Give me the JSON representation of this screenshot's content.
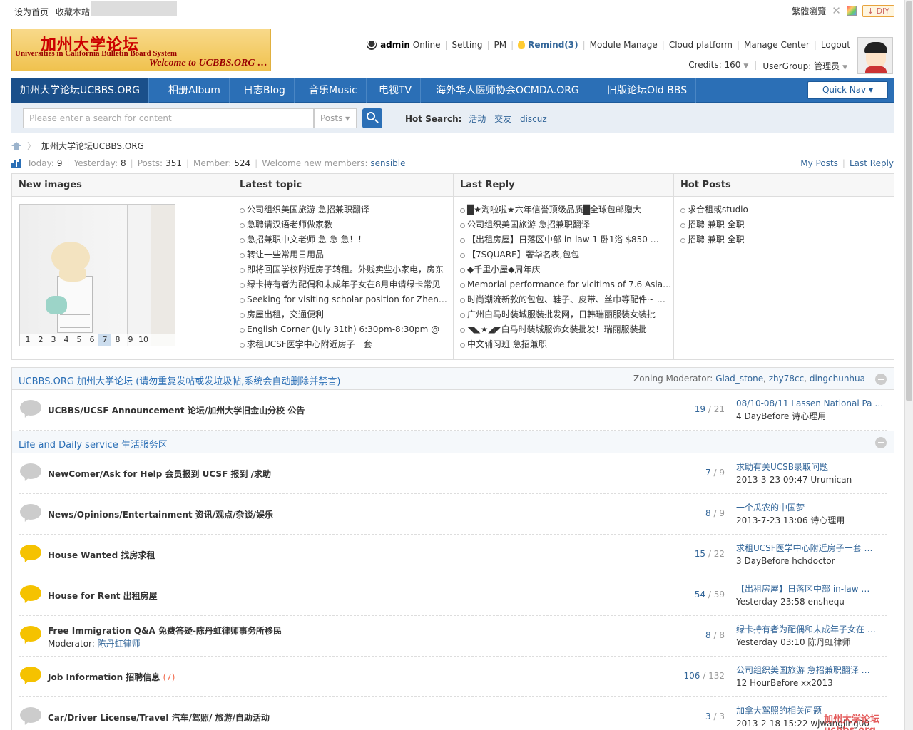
{
  "topbar": {
    "set_home": "设为首页",
    "bookmark": "收藏本站",
    "traditional": "繁體瀏覽",
    "diy": "DIY"
  },
  "logo": {
    "title_cn": "加州大学论坛",
    "title_en": "Universities in California Bulletin Board System",
    "welcome": "Welcome to UCBBS.ORG …"
  },
  "user": {
    "name": "admin",
    "status": "Online",
    "links": [
      "Setting",
      "PM"
    ],
    "remind": "Remind(3)",
    "links2": [
      "Module Manage",
      "Cloud platform",
      "Manage Center",
      "Logout"
    ],
    "credits": "Credits: 160",
    "usergroup": "UserGroup: 管理员"
  },
  "nav": {
    "items": [
      "加州大学论坛UCBBS.ORG",
      "相册Album",
      "日志Blog",
      "音乐Music",
      "电视TV",
      "海外华人医师协会OCMDA.ORG",
      "旧版论坛Old BBS"
    ],
    "quick_nav": "Quick Nav ▾"
  },
  "search": {
    "placeholder": "Please enter a search for content",
    "type": "Posts ▾",
    "hot_label": "Hot Search:",
    "hot": [
      "活动",
      "交友",
      "discuz"
    ]
  },
  "breadcrumb": {
    "current": "加州大学论坛UCBBS.ORG"
  },
  "stats": {
    "today_label": "Today:",
    "today": "9",
    "yesterday_label": "Yesterday:",
    "yesterday": "8",
    "posts_label": "Posts:",
    "posts": "351",
    "member_label": "Member:",
    "member": "524",
    "welcome_label": "Welcome new members:",
    "welcome_user": "sensible",
    "my_posts": "My Posts",
    "last_reply": "Last Reply"
  },
  "grid": {
    "images_title": "New images",
    "pager": [
      "1",
      "2",
      "3",
      "4",
      "5",
      "6",
      "7",
      "8",
      "9",
      "10"
    ],
    "pager_current": 6,
    "latest_title": "Latest topic",
    "latest": [
      "公司组织美国旅游 急招兼职翻译",
      "急聘请汉语老师做家教",
      "急招兼职中文老师 急 急 急！！",
      "转让一些常用日用品",
      "即将回国学校附近房子转租。外贱卖些小家电，房东",
      "绿卡持有者为配偶和未成年子女在8月申请绿卡常见",
      "Seeking for visiting scholar position for Zhenwei …",
      "房屋出租，交通便利",
      "English Corner (July 31th) 6:30pm-8:30pm @",
      "求租UCSF医学中心附近房子一套"
    ],
    "reply_title": "Last Reply",
    "replies": [
      "█★淘啦啦★六年信誉顶级品质█全球包邮赠大",
      "公司组织美国旅游 急招兼职翻译",
      "【出租房屋】日落区中部 in-law 1 卧1浴 $850 …",
      "【7SQUARE】奢华名表,包包",
      "◆千里小屋◆周年庆",
      "Memorial performance for vicitims of 7.6 Asiana fl",
      "时尚潮流新款的包包、鞋子、皮带、丝巾等配件~ …",
      "广州白马时装城服装批发网，日韩瑞丽服装女装批",
      "◥◣★◢◤白马时装城服饰女装批发！瑞丽服装批",
      "中文辅习班 急招兼职"
    ],
    "hot_title": "Hot Posts",
    "hot": [
      "求合租或studio",
      "招聘 兼职 全职",
      "招聘 兼职 全职"
    ]
  },
  "sections": [
    {
      "title": "UCBBS.ORG 加州大学论坛 (请勿重复发帖或发垃圾帖,系统会自动删除并禁言)",
      "mods_label": "Zoning Moderator:",
      "mods": [
        "Glad_stone",
        "zhy78cc",
        "dingchunhua"
      ]
    },
    {
      "title": "Life and Daily service 生活服务区"
    }
  ],
  "forums": [
    {
      "name": "UCBBS/UCSF Announcement 论坛/加州大学旧金山分校 公告",
      "threads": "19",
      "posts": "21",
      "last_title": "08/10-08/11 Lassen National Pa …",
      "last_meta": "4 DayBefore 诗心理用",
      "new": false
    },
    {
      "name": "NewComer/Ask for Help 会员报到 UCSF 报到 /求助",
      "threads": "7",
      "posts": "9",
      "last_title": "求助有关UCSB录取问题",
      "last_meta": "2013-3-23 09:47 Urumican",
      "new": false
    },
    {
      "name": "News/Opinions/Entertainment 资讯/观点/杂谈/娱乐",
      "threads": "8",
      "posts": "9",
      "last_title": "一个瓜农的中国梦",
      "last_meta": "2013-7-23 13:06 诗心理用",
      "new": false
    },
    {
      "name": "House Wanted 找房求租",
      "threads": "15",
      "posts": "22",
      "last_title": "求租UCSF医学中心附近房子一套 …",
      "last_meta": "3 DayBefore hchdoctor",
      "new": true
    },
    {
      "name": "House for Rent 出租房屋",
      "threads": "54",
      "posts": "59",
      "last_title": "【出租房屋】日落区中部 in-law …",
      "last_meta": "Yesterday 23:58 enshequ",
      "new": true
    },
    {
      "name": "Free Immigration Q&A 免费答疑-陈丹虹律师事务所移民",
      "moderator_label": "Moderator:",
      "moderator": "陈丹虹律师",
      "threads": "8",
      "posts": "8",
      "last_title": "绿卡持有者为配偶和未成年子女在 …",
      "last_meta": "Yesterday 03:10 陈丹虹律师",
      "new": true
    },
    {
      "name": "Job Information 招聘信息",
      "today": "(7)",
      "threads": "106",
      "posts": "132",
      "last_title": "公司组织美国旅游 急招兼职翻译 …",
      "last_meta": "12 HourBefore xx2013",
      "new": true
    },
    {
      "name": "Car/Driver License/Travel 汽车/驾照/ 旅游/自助活动",
      "threads": "3",
      "posts": "3",
      "last_title": "加拿大驾照的相关问题",
      "last_meta": "2013-2-18 15:22 wjwangjing00",
      "new": false
    }
  ],
  "watermark": "加州大学论坛ucbbs.org"
}
